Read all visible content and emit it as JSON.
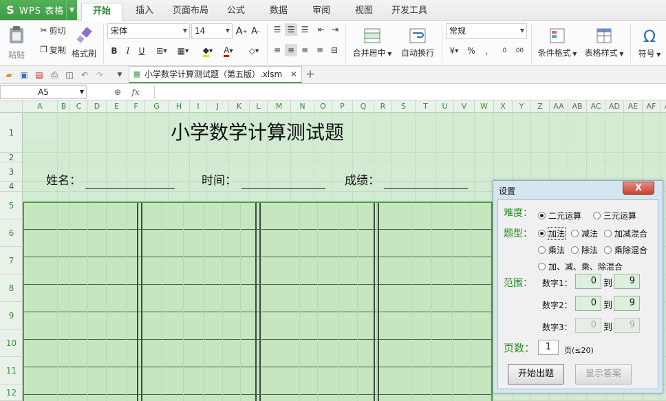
{
  "app": {
    "name": "WPS 表格",
    "logo": "S"
  },
  "menu": {
    "tabs": [
      "开始",
      "插入",
      "页面布局",
      "公式",
      "数据",
      "审阅",
      "视图",
      "开发工具"
    ],
    "active": 0
  },
  "ribbon": {
    "paste": "粘贴",
    "cut": "剪切",
    "copy": "复制",
    "format_painter": "格式刷",
    "font_name": "宋体",
    "font_size": "14",
    "merge_center": "合并居中",
    "wrap_text": "自动换行",
    "number_format": "常规",
    "cond_format": "条件格式",
    "table_style": "表格样式",
    "symbol": "符号"
  },
  "document": {
    "tab_title": "小学数学计算测试题（第五版）.xlsm"
  },
  "formula_bar": {
    "cell_ref": "A5",
    "fx": "fx"
  },
  "columns": [
    "A",
    "B",
    "C",
    "D",
    "E",
    "F",
    "G",
    "H",
    "I",
    "J",
    "K",
    "L",
    "M",
    "N",
    "O",
    "P",
    "Q",
    "R",
    "S",
    "T",
    "U",
    "V",
    "W",
    "X",
    "Y",
    "Z",
    "AA",
    "AB",
    "AC",
    "AD",
    "AE",
    "AF",
    "A"
  ],
  "rows": [
    "1",
    "2",
    "3",
    "4",
    "5",
    "6",
    "7",
    "8",
    "9",
    "10",
    "11",
    "12"
  ],
  "sheet": {
    "title": "小学数学计算测试题",
    "name_label": "姓名：",
    "time_label": "时间：",
    "score_label": "成绩："
  },
  "dialog": {
    "title": "设置",
    "close": "X",
    "difficulty_label": "难度：",
    "difficulty_options": [
      "二元运算",
      "三元运算"
    ],
    "type_label": "题型：",
    "type_options": [
      "加法",
      "减法",
      "加减混合",
      "乘法",
      "除法",
      "乘除混合",
      "加、减、乘、除混合"
    ],
    "range_label": "范围：",
    "num1_label": "数字1：",
    "num1_from": "0",
    "num1_to": "9",
    "num2_label": "数字2：",
    "num2_from": "0",
    "num2_to": "9",
    "num3_label": "数字3：",
    "num3_from": "0",
    "num3_to": "9",
    "to_label": "到",
    "pages_label": "页数：",
    "pages_value": "1",
    "pages_hint": "页(≤20)",
    "start_button": "开始出题",
    "answer_button": "显示答案"
  },
  "colors": {
    "brand": "#3f9a44",
    "sheet_bg": "#d3ead3",
    "question_bg": "#c5e6bf",
    "dialog_bg": "#d6e6f1"
  }
}
